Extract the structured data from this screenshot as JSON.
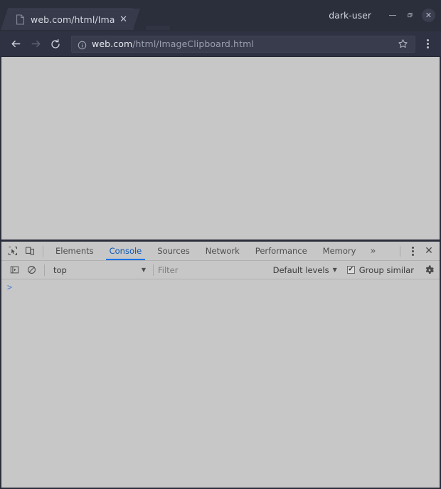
{
  "window": {
    "user_label": "dark-user",
    "minimize_label": "−",
    "maximize_label": "□",
    "close_label": "✕"
  },
  "tabs": [
    {
      "title": "web.com/html/Ima",
      "favicon": "page-icon",
      "close_label": "✕"
    }
  ],
  "navigation": {
    "back_label": "←",
    "forward_label": "→",
    "reload_label": "↻",
    "security_icon": "info-circle-icon",
    "url_host": "web.com",
    "url_path": "/html/ImageClipboard.html",
    "bookmark_icon": "star-icon",
    "menu_icon": "three-dot-menu-icon"
  },
  "devtools": {
    "inspect_icon": "inspect-element-icon",
    "device_icon": "device-toolbar-icon",
    "tabs": [
      {
        "label": "Elements",
        "active": false
      },
      {
        "label": "Console",
        "active": true
      },
      {
        "label": "Sources",
        "active": false
      },
      {
        "label": "Network",
        "active": false
      },
      {
        "label": "Performance",
        "active": false
      },
      {
        "label": "Memory",
        "active": false
      }
    ],
    "overflow_label": "»",
    "more_options_icon": "three-dot-menu-icon",
    "close_label": "✕",
    "console": {
      "sidebar_toggle_icon": "console-sidebar-icon",
      "clear_icon": "clear-console-icon",
      "context_value": "top",
      "context_caret": "▼",
      "filter_placeholder": "Filter",
      "levels_label": "Default levels",
      "levels_caret": "▼",
      "group_similar_label": "Group similar",
      "group_similar_checked": true,
      "checkmark": "✔",
      "settings_icon": "gear-icon",
      "prompt_symbol": ">"
    }
  },
  "colors": {
    "chrome_frame": "#2b2e3b",
    "nav_bar": "#2f3242",
    "tab_active": "#363a4a",
    "omnibox": "#383c4c",
    "page_background": "#c7c7c7",
    "devtools_background": "#c7c7c7",
    "accent_blue": "#1a73e8",
    "prompt_blue": "#4f7fd4"
  }
}
